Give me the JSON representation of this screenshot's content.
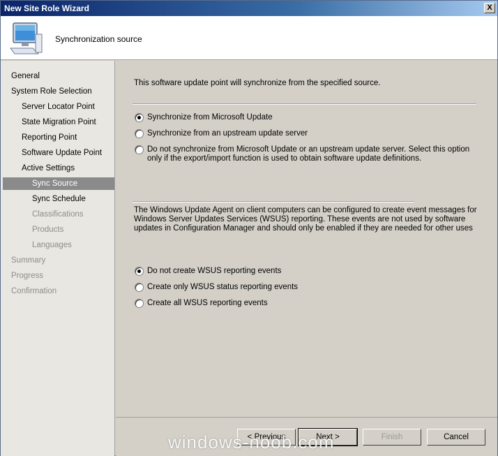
{
  "window": {
    "title": "New Site Role Wizard",
    "close_glyph": "X"
  },
  "header": {
    "title": "Synchronization source",
    "icon": "computer-icon"
  },
  "nav": {
    "items": [
      {
        "label": "General",
        "state": "normal"
      },
      {
        "label": "System Role Selection",
        "state": "normal"
      },
      {
        "label": "Server Locator Point",
        "state": "normal"
      },
      {
        "label": "State Migration Point",
        "state": "normal"
      },
      {
        "label": "Reporting Point",
        "state": "normal"
      },
      {
        "label": "Software Update Point",
        "state": "normal"
      },
      {
        "label": "Active Settings",
        "state": "normal"
      },
      {
        "label": "Sync Source",
        "state": "selected"
      },
      {
        "label": "Sync Schedule",
        "state": "normal"
      },
      {
        "label": "Classifications",
        "state": "disabled"
      },
      {
        "label": "Products",
        "state": "disabled"
      },
      {
        "label": "Languages",
        "state": "disabled"
      },
      {
        "label": "Summary",
        "state": "disabled"
      },
      {
        "label": "Progress",
        "state": "disabled"
      },
      {
        "label": "Confirmation",
        "state": "disabled"
      }
    ]
  },
  "content": {
    "intro": "This software update point will synchronize from the specified source.",
    "sync_options": [
      {
        "label": "Synchronize from Microsoft Update",
        "checked": true
      },
      {
        "label": "Synchronize from an upstream update server",
        "checked": false
      },
      {
        "label": "Do not synchronize from Microsoft Update or an upstream update server. Select this option only if the export/import function is used to obtain software update definitions.",
        "checked": false
      }
    ],
    "wsus_description": "The Windows Update Agent on client computers can be configured to create event messages for Windows Server Updates Services (WSUS) reporting. These events are not used by software updates in Configuration Manager and should only be enabled if they are needed for other uses",
    "reporting_options": [
      {
        "label": "Do not create WSUS reporting events",
        "checked": true
      },
      {
        "label": "Create only WSUS status reporting events",
        "checked": false
      },
      {
        "label": "Create all WSUS reporting events",
        "checked": false
      }
    ]
  },
  "footer": {
    "previous_label": "< Previous",
    "next_label": "Next >",
    "finish_label": "Finish",
    "cancel_label": "Cancel"
  },
  "watermark": "windows-noob.com"
}
